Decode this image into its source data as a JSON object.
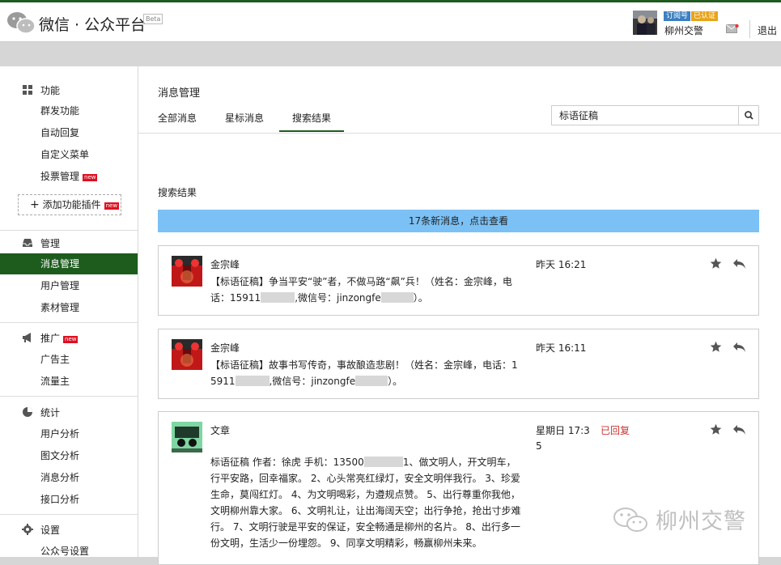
{
  "header": {
    "app_title": "微信 · 公众平台",
    "beta": "Beta",
    "account_type": "订阅号",
    "verified": "已认证",
    "account_name": "柳州交警",
    "logout": "退出"
  },
  "sidebar": {
    "sections": [
      {
        "title": "功能",
        "icon": "grid-icon",
        "items": [
          {
            "label": "群发功能"
          },
          {
            "label": "自动回复"
          },
          {
            "label": "自定义菜单"
          },
          {
            "label": "投票管理",
            "new": "new"
          }
        ]
      },
      {
        "title": "管理",
        "icon": "inbox-icon",
        "items": [
          {
            "label": "消息管理",
            "active": true
          },
          {
            "label": "用户管理"
          },
          {
            "label": "素材管理"
          }
        ]
      },
      {
        "title": "推广",
        "new": "new",
        "icon": "megaphone-icon",
        "items": [
          {
            "label": "广告主"
          },
          {
            "label": "流量主"
          }
        ]
      },
      {
        "title": "统计",
        "icon": "pie-chart-icon",
        "items": [
          {
            "label": "用户分析"
          },
          {
            "label": "图文分析"
          },
          {
            "label": "消息分析"
          },
          {
            "label": "接口分析"
          }
        ]
      },
      {
        "title": "设置",
        "icon": "gear-icon",
        "items": [
          {
            "label": "公众号设置"
          }
        ]
      }
    ],
    "add_plugin": "添加功能插件",
    "add_plugin_new": "new"
  },
  "main": {
    "title": "消息管理",
    "tabs": [
      {
        "label": "全部消息"
      },
      {
        "label": "星标消息"
      },
      {
        "label": "搜索结果",
        "active": true
      }
    ],
    "search": {
      "value": "标语征稿",
      "icon": "search-icon"
    },
    "result_title": "搜索结果",
    "new_messages_bar": "17条新消息，点击查看",
    "messages": [
      {
        "sender": "金宗峰",
        "time": "昨天 16:21",
        "content_1": "【标语征稿】争当平安“驶”者，不做马路“飙”兵！（姓名：金宗峰，电话：15911",
        "content_2": ",微信号：jinzongfe",
        "content_3": "）。"
      },
      {
        "sender": "金宗峰",
        "time": "昨天 16:11",
        "content_1": "【标语征稿】故事书写传奇，事故酿造悲剧！（姓名：金宗峰，电话：15911",
        "content_2": ",微信号：jinzongfe",
        "content_3": "）。"
      },
      {
        "sender": "文章",
        "time": "星期日 17:35",
        "status": "已回复",
        "content_1": "标语征稿 作者：徐虎 手机：13500",
        "content_2": "1、做文明人，开文明车，行平安路，回幸福家。 2、心头常亮红绿灯，安全文明伴我行。 3、珍爱生命，莫闯红灯。 4、为文明喝彩，为遵规点赞。 5、出行尊重你我他，文明柳州靠大家。 6、文明礼让，让出海阔天空；出行争抢，抢出寸步难行。 7、文明行驶是平安的保证，安全畅通是柳州的名片。 8、出行多一份文明，生活少一份埋怨。 9、同享文明精彩，畅赢柳州未来。"
      }
    ]
  },
  "watermark": "柳州交警",
  "colors": {
    "accent_green": "#1d5c1d",
    "new_bar_blue": "#7cc1f5",
    "replied_red": "#cc3333"
  }
}
